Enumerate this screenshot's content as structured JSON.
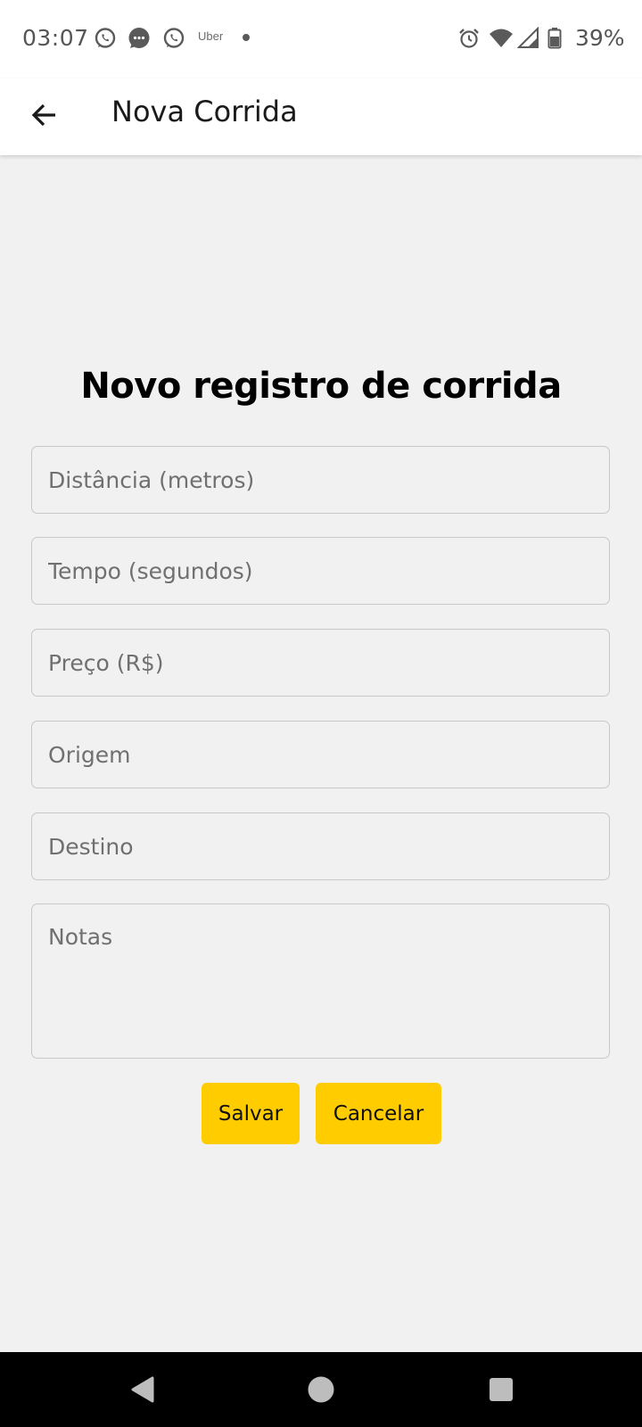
{
  "status_bar": {
    "time": "03:07",
    "notifications": [
      "whatsapp-icon",
      "messages-icon",
      "whatsapp-icon"
    ],
    "uber_label": "Uber",
    "battery": "39%"
  },
  "app_bar": {
    "title": "Nova Corrida"
  },
  "form": {
    "heading": "Novo registro de corrida",
    "distance_placeholder": "Distância (metros)",
    "time_placeholder": "Tempo (segundos)",
    "price_placeholder": "Preço (R$)",
    "origin_placeholder": "Origem",
    "destination_placeholder": "Destino",
    "notes_placeholder": "Notas",
    "save_label": "Salvar",
    "cancel_label": "Cancelar"
  },
  "colors": {
    "accent": "#ffcc00",
    "background": "#f1f1f1",
    "nav_bar": "#000000"
  }
}
